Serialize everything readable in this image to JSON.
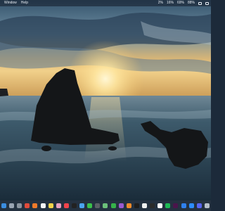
{
  "menubar": {
    "items": [
      {
        "label": "Window"
      },
      {
        "label": "Help"
      }
    ],
    "status": [
      {
        "text": "2%"
      },
      {
        "text": "16%"
      },
      {
        "text": "69%"
      },
      {
        "text": "88%"
      }
    ]
  },
  "dock": {
    "apps": [
      {
        "name": "finder-icon",
        "color": "#3b8de0"
      },
      {
        "name": "launchpad-icon",
        "color": "#9aa4b2"
      },
      {
        "name": "settings-icon",
        "color": "#8a939e"
      },
      {
        "name": "chrome-icon",
        "color": "#e14b3b"
      },
      {
        "name": "firefox-icon",
        "color": "#f07a2a"
      },
      {
        "name": "calendar-icon",
        "color": "#f4f4f4"
      },
      {
        "name": "notes-icon",
        "color": "#f5d34a"
      },
      {
        "name": "photos-icon",
        "color": "#e8a0c0"
      },
      {
        "name": "music-icon",
        "color": "#f2434a"
      },
      {
        "name": "terminal-icon",
        "color": "#222222"
      },
      {
        "name": "mail-icon",
        "color": "#4aa3f0"
      },
      {
        "name": "messages-icon",
        "color": "#3ac14a"
      },
      {
        "name": "camera-icon",
        "color": "#5b5f66"
      },
      {
        "name": "maps-icon",
        "color": "#6cc07a"
      },
      {
        "name": "facetime-icon",
        "color": "#36b24a"
      },
      {
        "name": "podcasts-icon",
        "color": "#9b59d0"
      },
      {
        "name": "books-icon",
        "color": "#f08a2a"
      },
      {
        "name": "tv-icon",
        "color": "#1e1e1e"
      },
      {
        "name": "news-icon",
        "color": "#f0f0f0"
      },
      {
        "name": "stocks-icon",
        "color": "#2b2b2b"
      },
      {
        "name": "reminders-icon",
        "color": "#ffffff"
      },
      {
        "name": "spotify-icon",
        "color": "#1db954"
      },
      {
        "name": "slack-icon",
        "color": "#4a154b"
      },
      {
        "name": "vscode-icon",
        "color": "#2f80ed"
      },
      {
        "name": "zoom-icon",
        "color": "#2d8cff"
      },
      {
        "name": "discord-icon",
        "color": "#5865f2"
      },
      {
        "name": "trash-icon",
        "color": "#b8c0ca"
      }
    ]
  }
}
